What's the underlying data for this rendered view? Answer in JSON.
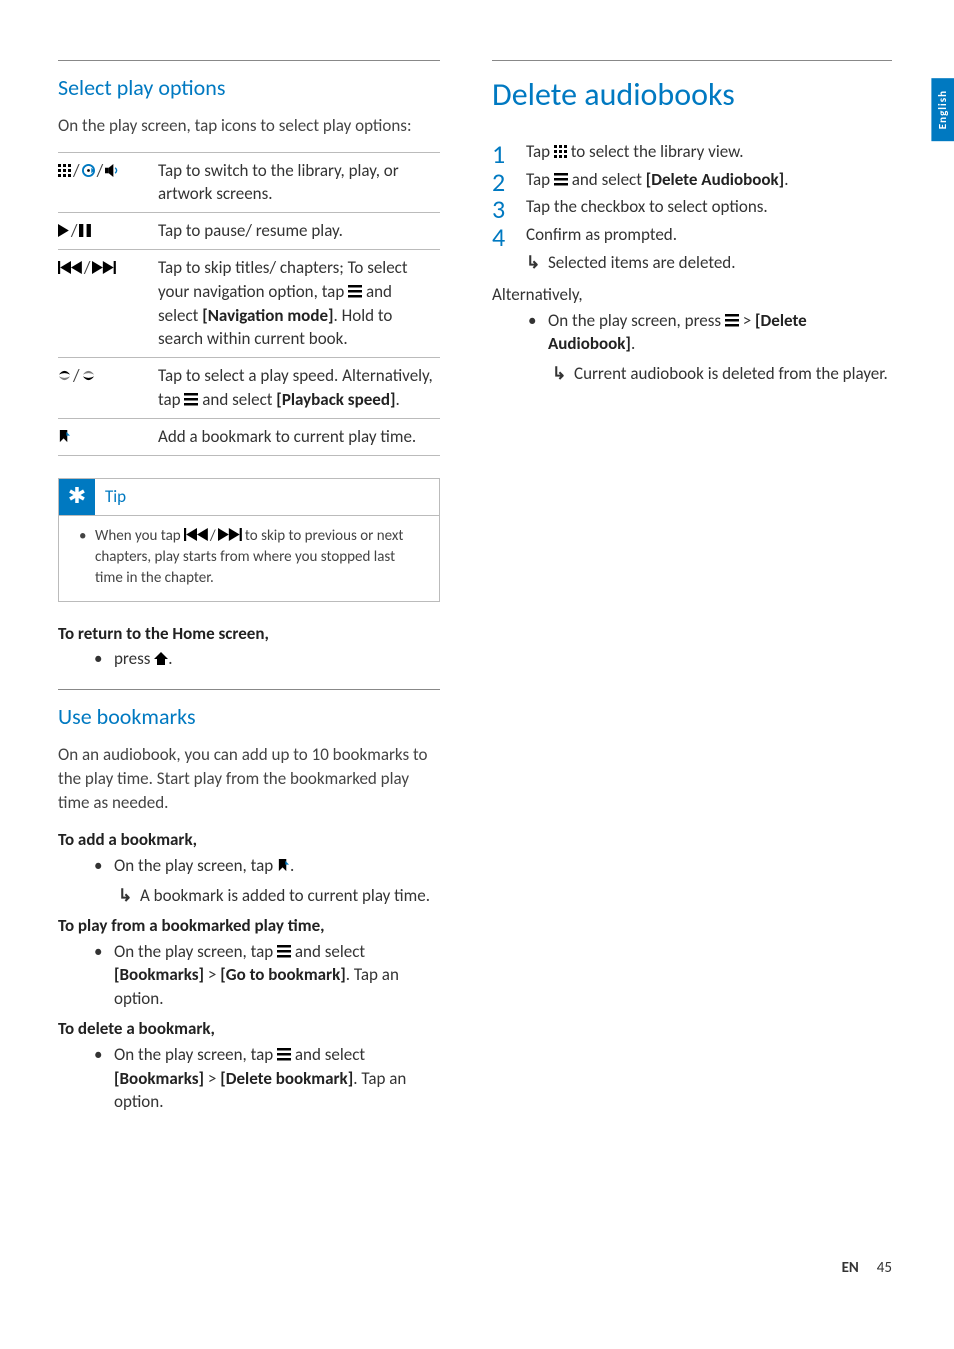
{
  "langTab": "English",
  "footer": {
    "lang": "EN",
    "page": "45"
  },
  "left": {
    "sec1": {
      "title": "Select play options",
      "intro": "On the play screen, tap icons to select play options:",
      "rows": [
        {
          "desc": "Tap to switch to the library, play, or artwork screens."
        },
        {
          "desc": "Tap to pause/ resume play."
        },
        {
          "desc_a": "Tap to skip titles/ chapters; To select your navigation option, tap ",
          "desc_b": " and select ",
          "nav": "[Navigation mode]",
          "desc_c": ". Hold to search within current book."
        },
        {
          "desc_a": "Tap to select a play speed. Alternatively, tap ",
          "desc_b": " and select ",
          "pbs": "[Playback speed]",
          "desc_c": "."
        },
        {
          "desc": "Add a bookmark to current play time."
        }
      ],
      "tip": {
        "label": "Tip",
        "text_a": "When you tap ",
        "text_b": " to skip to previous or next chapters, play starts from where you stopped last time in the chapter."
      },
      "return_head": "To return to the Home screen,",
      "return_item": "press "
    },
    "sec2": {
      "title": "Use bookmarks",
      "intro": "On an audiobook, you can add up to 10 bookmarks to the play time. Start play from the bookmarked play time as needed.",
      "add_head": "To add a bookmark,",
      "add_item": "On the play screen, tap ",
      "add_result": "A bookmark is added to current play time.",
      "play_head": "To play from a bookmarked play time,",
      "play_item_a": "On the play screen, tap ",
      "play_item_b": " and select ",
      "bookmarks": "[Bookmarks]",
      "gt": ">",
      "goto": "[Go to bookmark]",
      "play_item_c": ". Tap an option.",
      "del_head": "To delete a bookmark,",
      "del_item_a": "On the play screen, tap ",
      "del_item_b": " and select ",
      "delbm": "[Delete bookmark]",
      "del_item_c": ". Tap an option."
    }
  },
  "right": {
    "title": "Delete audiobooks",
    "s1_a": "Tap ",
    "s1_b": " to select the library view.",
    "s2_a": "Tap ",
    "s2_b": " and select ",
    "s2_c": "[Delete Audiobook]",
    "s2_d": ".",
    "s3": "Tap the checkbox to select options.",
    "s4": "Confirm as prompted.",
    "s4_res": "Selected items are deleted.",
    "alt": "Alternatively,",
    "alt_a": "On the play screen, press ",
    "alt_b": " > ",
    "alt_c": "[Delete Audiobook]",
    "alt_d": ".",
    "alt_res": "Current audiobook is deleted from the player."
  }
}
